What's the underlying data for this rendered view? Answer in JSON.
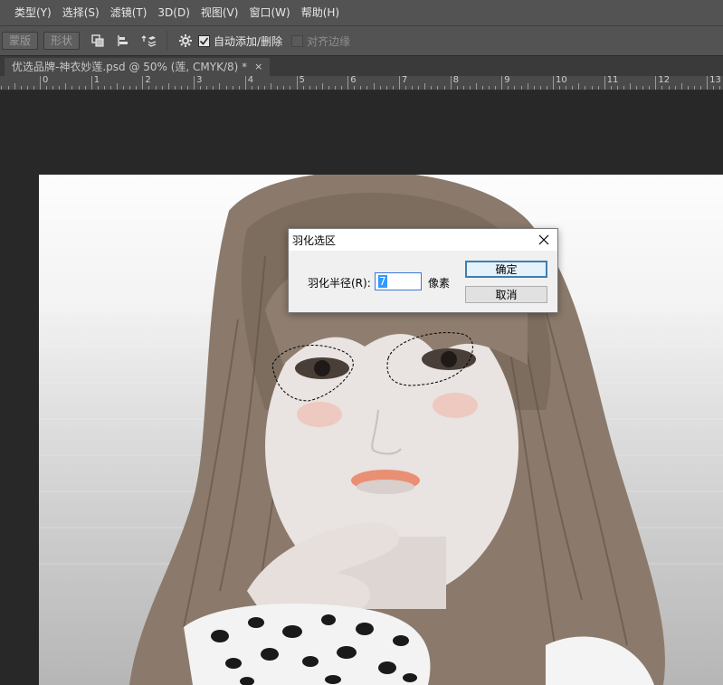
{
  "menu": [
    "类型(Y)",
    "选择(S)",
    "滤镜(T)",
    "3D(D)",
    "视图(V)",
    "窗口(W)",
    "帮助(H)"
  ],
  "options": {
    "mask_button": "蒙版",
    "shape_button": "形状",
    "auto_add_delete": "自动添加/删除",
    "auto_add_delete_checked": true,
    "align_edges": "对齐边缘",
    "align_edges_checked": false
  },
  "document_tab": {
    "title": "优选品牌-神衣妙莲.psd @ 50% (莲, CMYK/8) *",
    "close": "×"
  },
  "ruler": {
    "labels": [
      "0",
      "1",
      "2",
      "3",
      "4",
      "5",
      "6",
      "7",
      "8",
      "9",
      "10",
      "11",
      "12",
      "13"
    ]
  },
  "dialog": {
    "title": "羽化选区",
    "radius_label": "羽化半径(R):",
    "radius_value": "7",
    "unit": "像素",
    "ok_label": "确定",
    "cancel_label": "取消"
  },
  "icons": [
    "combine-shapes-icon",
    "align-icon",
    "arrange-icon",
    "gear-icon",
    "close-icon"
  ],
  "colors": {
    "ui_panel": "#535353",
    "workspace": "#282828",
    "dialog_accent": "#3c7fb1"
  }
}
